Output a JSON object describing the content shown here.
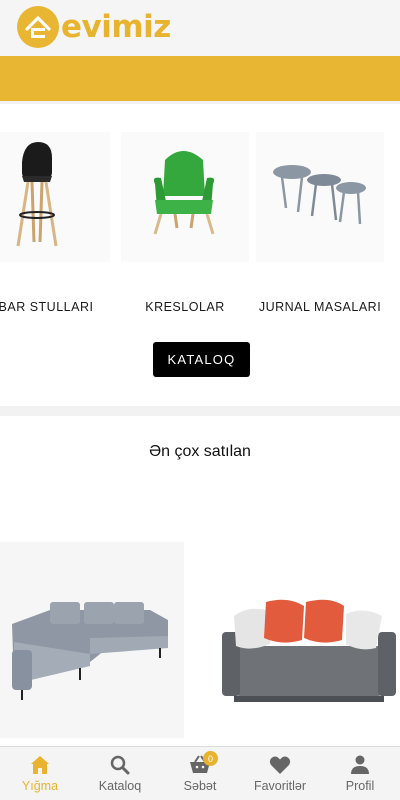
{
  "brand": {
    "name": "evimiz",
    "accent_color": "#e9b633"
  },
  "categories": [
    {
      "label": "BAR STULLARI",
      "icon": "bar-stool-image"
    },
    {
      "label": "KRESLOLAR",
      "icon": "armchair-image"
    },
    {
      "label": "JURNAL MASALARI",
      "icon": "coffee-tables-image"
    }
  ],
  "catalog_button": "KATALOQ",
  "best_sellers": {
    "title": "Ən çox satılan",
    "products": [
      "sofa-corner-image",
      "sofa-orange-pillows-image"
    ]
  },
  "nav": {
    "items": [
      {
        "label": "Yığma",
        "icon": "home-icon",
        "active": true
      },
      {
        "label": "Kataloq",
        "icon": "search-icon"
      },
      {
        "label": "Səbət",
        "icon": "basket-icon",
        "badge": "0"
      },
      {
        "label": "Favoritlər",
        "icon": "heart-icon"
      },
      {
        "label": "Profil",
        "icon": "person-icon"
      }
    ]
  }
}
